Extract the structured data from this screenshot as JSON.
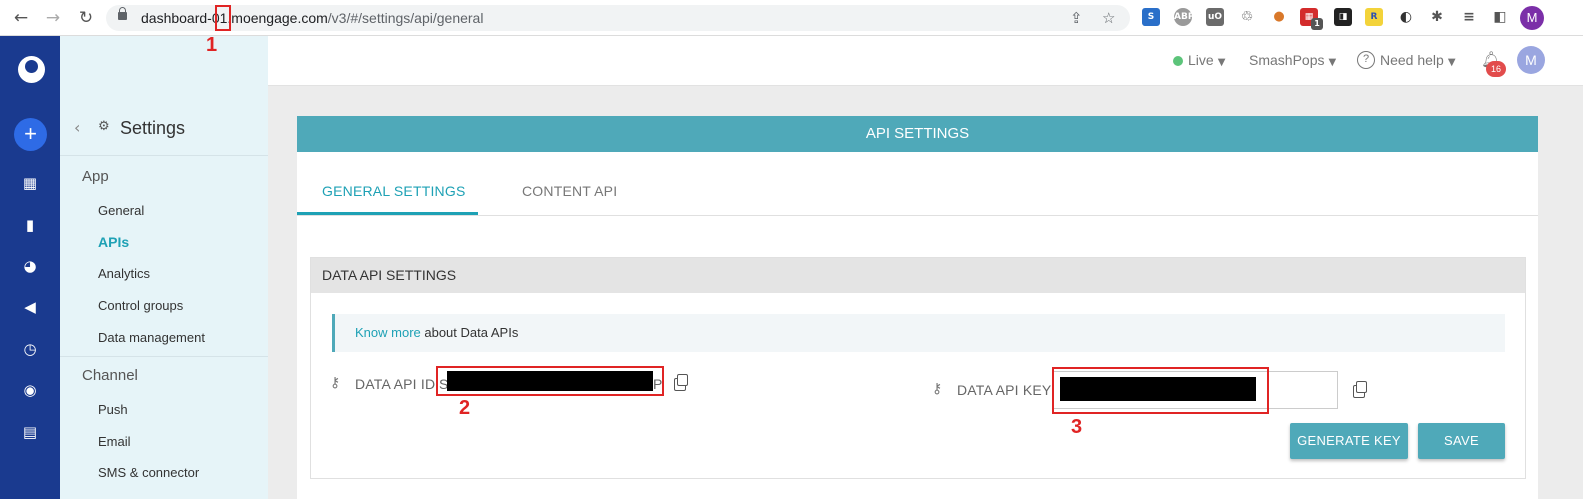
{
  "browser": {
    "url_host": "dashboard-01.moengage.com",
    "url_path": "/v3/#/settings/api/general",
    "profile_initial": "M",
    "extension_badge": "1"
  },
  "sidebar": {
    "title": "Settings",
    "sections": [
      {
        "label": "App",
        "items": [
          "General",
          "APIs",
          "Analytics",
          "Control groups",
          "Data management"
        ]
      },
      {
        "label": "Channel",
        "items": [
          "Push",
          "Email",
          "SMS & connector"
        ]
      }
    ],
    "active_item": "APIs"
  },
  "header": {
    "status": "Live",
    "workspace": "SmashPops",
    "help": "Need help",
    "notification_count": "16",
    "avatar_initial": "M"
  },
  "panel": {
    "title": "API SETTINGS",
    "tabs": [
      "GENERAL SETTINGS",
      "CONTENT API"
    ],
    "active_tab": "GENERAL SETTINGS",
    "card_title": "DATA API SETTINGS",
    "info_link": "Know more",
    "info_text": " about Data APIs",
    "api_id_label": "DATA API ID:",
    "api_id_visible_prefix": "S",
    "api_id_visible_suffix": "P",
    "api_key_label": "DATA API KEY:",
    "generate_button": "GENERATE KEY",
    "save_button": "SAVE"
  },
  "annotations": [
    "1",
    "2",
    "3"
  ],
  "colors": {
    "accent": "#1ea1b5",
    "header_teal": "#4fa9b9",
    "rail": "#1a3a8f",
    "sidebar_bg": "#e6f4f8",
    "annotation": "#e02424",
    "live": "#5cc47a"
  }
}
